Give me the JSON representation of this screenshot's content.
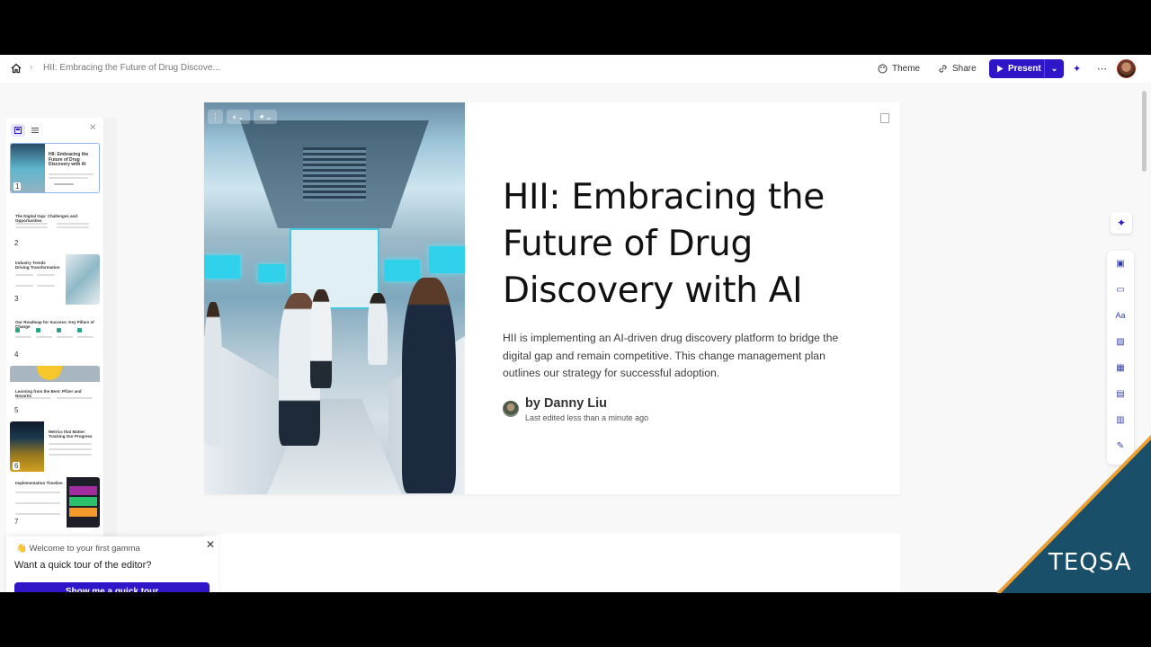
{
  "breadcrumb": {
    "doc_title": "HII: Embracing the Future of Drug Discove..."
  },
  "toolbar": {
    "theme_label": "Theme",
    "share_label": "Share",
    "present_label": "Present"
  },
  "sidebar": {
    "slides": [
      {
        "num": "1",
        "title": "HII: Embracing the Future of Drug Discovery with AI"
      },
      {
        "num": "2",
        "title": "The Digital Gap: Challenges and Opportunities"
      },
      {
        "num": "3",
        "title": "Industry Trends Driving Transformation"
      },
      {
        "num": "4",
        "title": "Our Roadmap for Success: Key Pillars of Change"
      },
      {
        "num": "5",
        "title": "Learning from the Best: Pfizer and Novartis"
      },
      {
        "num": "6",
        "title": "Metrics that Matter: Tracking Our Progress"
      },
      {
        "num": "7",
        "title": "Implementation Timeline"
      }
    ]
  },
  "card": {
    "title": "HII: Embracing the Future of Drug Discovery with AI",
    "description": "HII is implementing an AI-driven drug discovery platform to bridge the digital gap and remain competitive. This change management plan outlines our strategy for successful adoption.",
    "author": "by Danny Liu",
    "edited": "Last edited less than a minute ago"
  },
  "tour": {
    "greeting": "👋 Welcome to your first gamma",
    "question": "Want a quick tour of the editor?",
    "button": "Show me a quick tour"
  },
  "watermark": {
    "text": "TEQSA"
  },
  "colors": {
    "accent": "#2f17c9",
    "watermark_bg": "#1a4f69",
    "watermark_stripe": "#f0a030"
  },
  "icons": [
    "home-icon",
    "theme-icon",
    "share-icon",
    "play-icon",
    "chevron-down-icon",
    "sparkle-icon",
    "more-icon",
    "ai-sparkle-icon"
  ]
}
